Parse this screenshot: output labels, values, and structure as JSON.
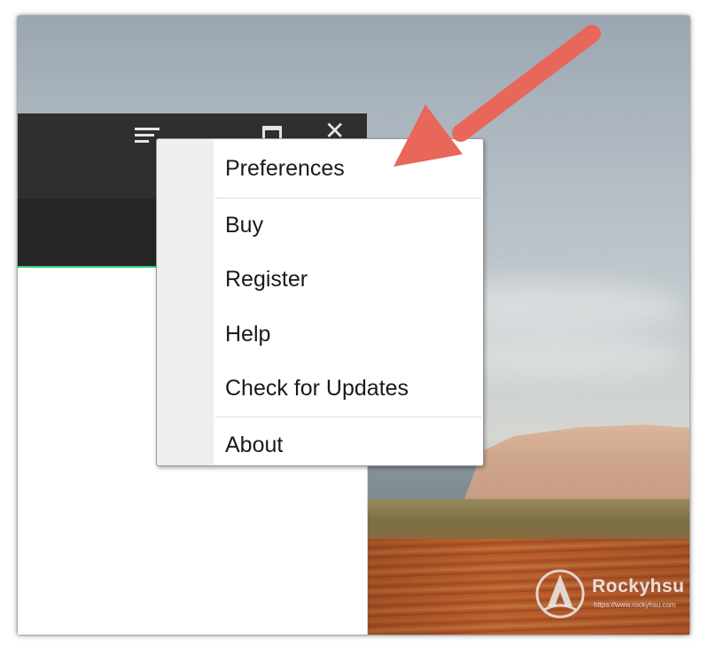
{
  "context_menu": {
    "items": [
      {
        "label": "Preferences"
      },
      {
        "label": "Buy"
      },
      {
        "label": "Register"
      },
      {
        "label": "Help"
      },
      {
        "label": "Check for Updates"
      },
      {
        "label": "About"
      }
    ]
  },
  "window_controls": {
    "menu_icon": "hamburger-menu-icon",
    "maximize_icon": "maximize-icon",
    "close_icon": "close-icon"
  },
  "annotation": {
    "arrow_color": "#e8665a"
  },
  "watermark": {
    "brand": "Rockyhsu",
    "url": "https://www.rockyhsu.com"
  },
  "colors": {
    "titlebar": "#2f2f2f",
    "accent": "#2ecc71",
    "menu_gutter": "#efefef"
  }
}
